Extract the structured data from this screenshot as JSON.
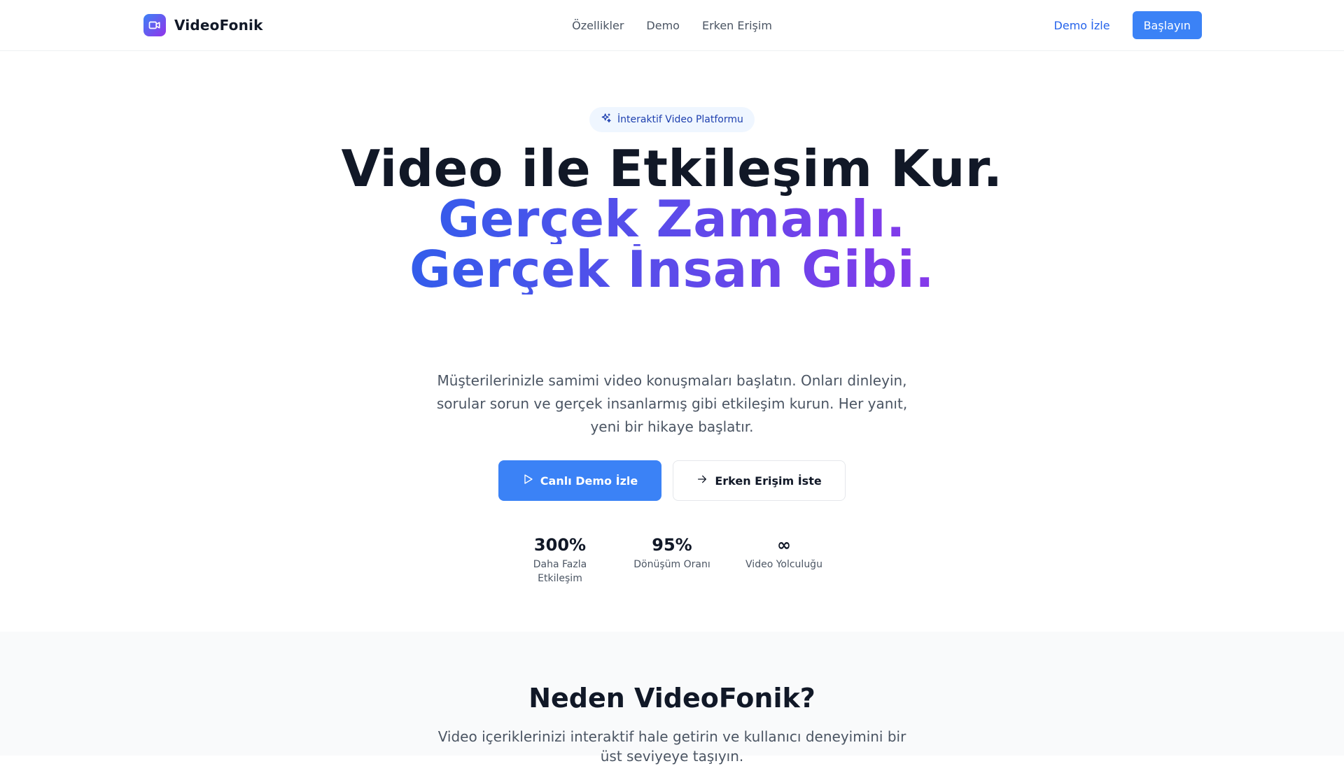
{
  "brand": {
    "name": "VideoFonik",
    "logo_icon": "video-camera-icon",
    "gradient": [
      "#3b82f6",
      "#9333ea"
    ]
  },
  "nav": {
    "items": [
      {
        "label": "Özellikler"
      },
      {
        "label": "Demo"
      },
      {
        "label": "Erken Erişim"
      }
    ]
  },
  "header_actions": {
    "demo_link": "Demo İzle",
    "start_button": "Başlayın"
  },
  "hero": {
    "badge": {
      "icon": "sparkles-icon",
      "label": "İnteraktif Video Platformu"
    },
    "title_line1": "Video ile Etkileşim Kur.",
    "title_line2": "Gerçek Zamanlı.",
    "title_line3": "Gerçek İnsan Gibi.",
    "subtitle": "Müşterilerinizle samimi video konuşmaları başlatın. Onları dinleyin, sorular sorun ve gerçek insanlarmış gibi etkileşim kurun. Her yanıt, yeni bir hikaye başlatır.",
    "primary_cta": {
      "icon": "play-icon",
      "label": "Canlı Demo İzle"
    },
    "secondary_cta": {
      "icon": "arrow-right-icon",
      "label": "Erken Erişim İste"
    },
    "stats": [
      {
        "value": "300%",
        "label": "Daha Fazla Etkileşim"
      },
      {
        "value": "95%",
        "label": "Dönüşüm Oranı"
      },
      {
        "value": "∞",
        "label": "Video Yolculuğu"
      }
    ]
  },
  "why": {
    "title": "Neden VideoFonik?",
    "subtitle": "Video içeriklerinizi interaktif hale getirin ve kullanıcı deneyimini bir üst seviyeye taşıyın."
  },
  "colors": {
    "accent": "#3b82f6",
    "link": "#2563eb",
    "badge_bg": "#eff6ff",
    "section_bg": "#f9fafb"
  }
}
